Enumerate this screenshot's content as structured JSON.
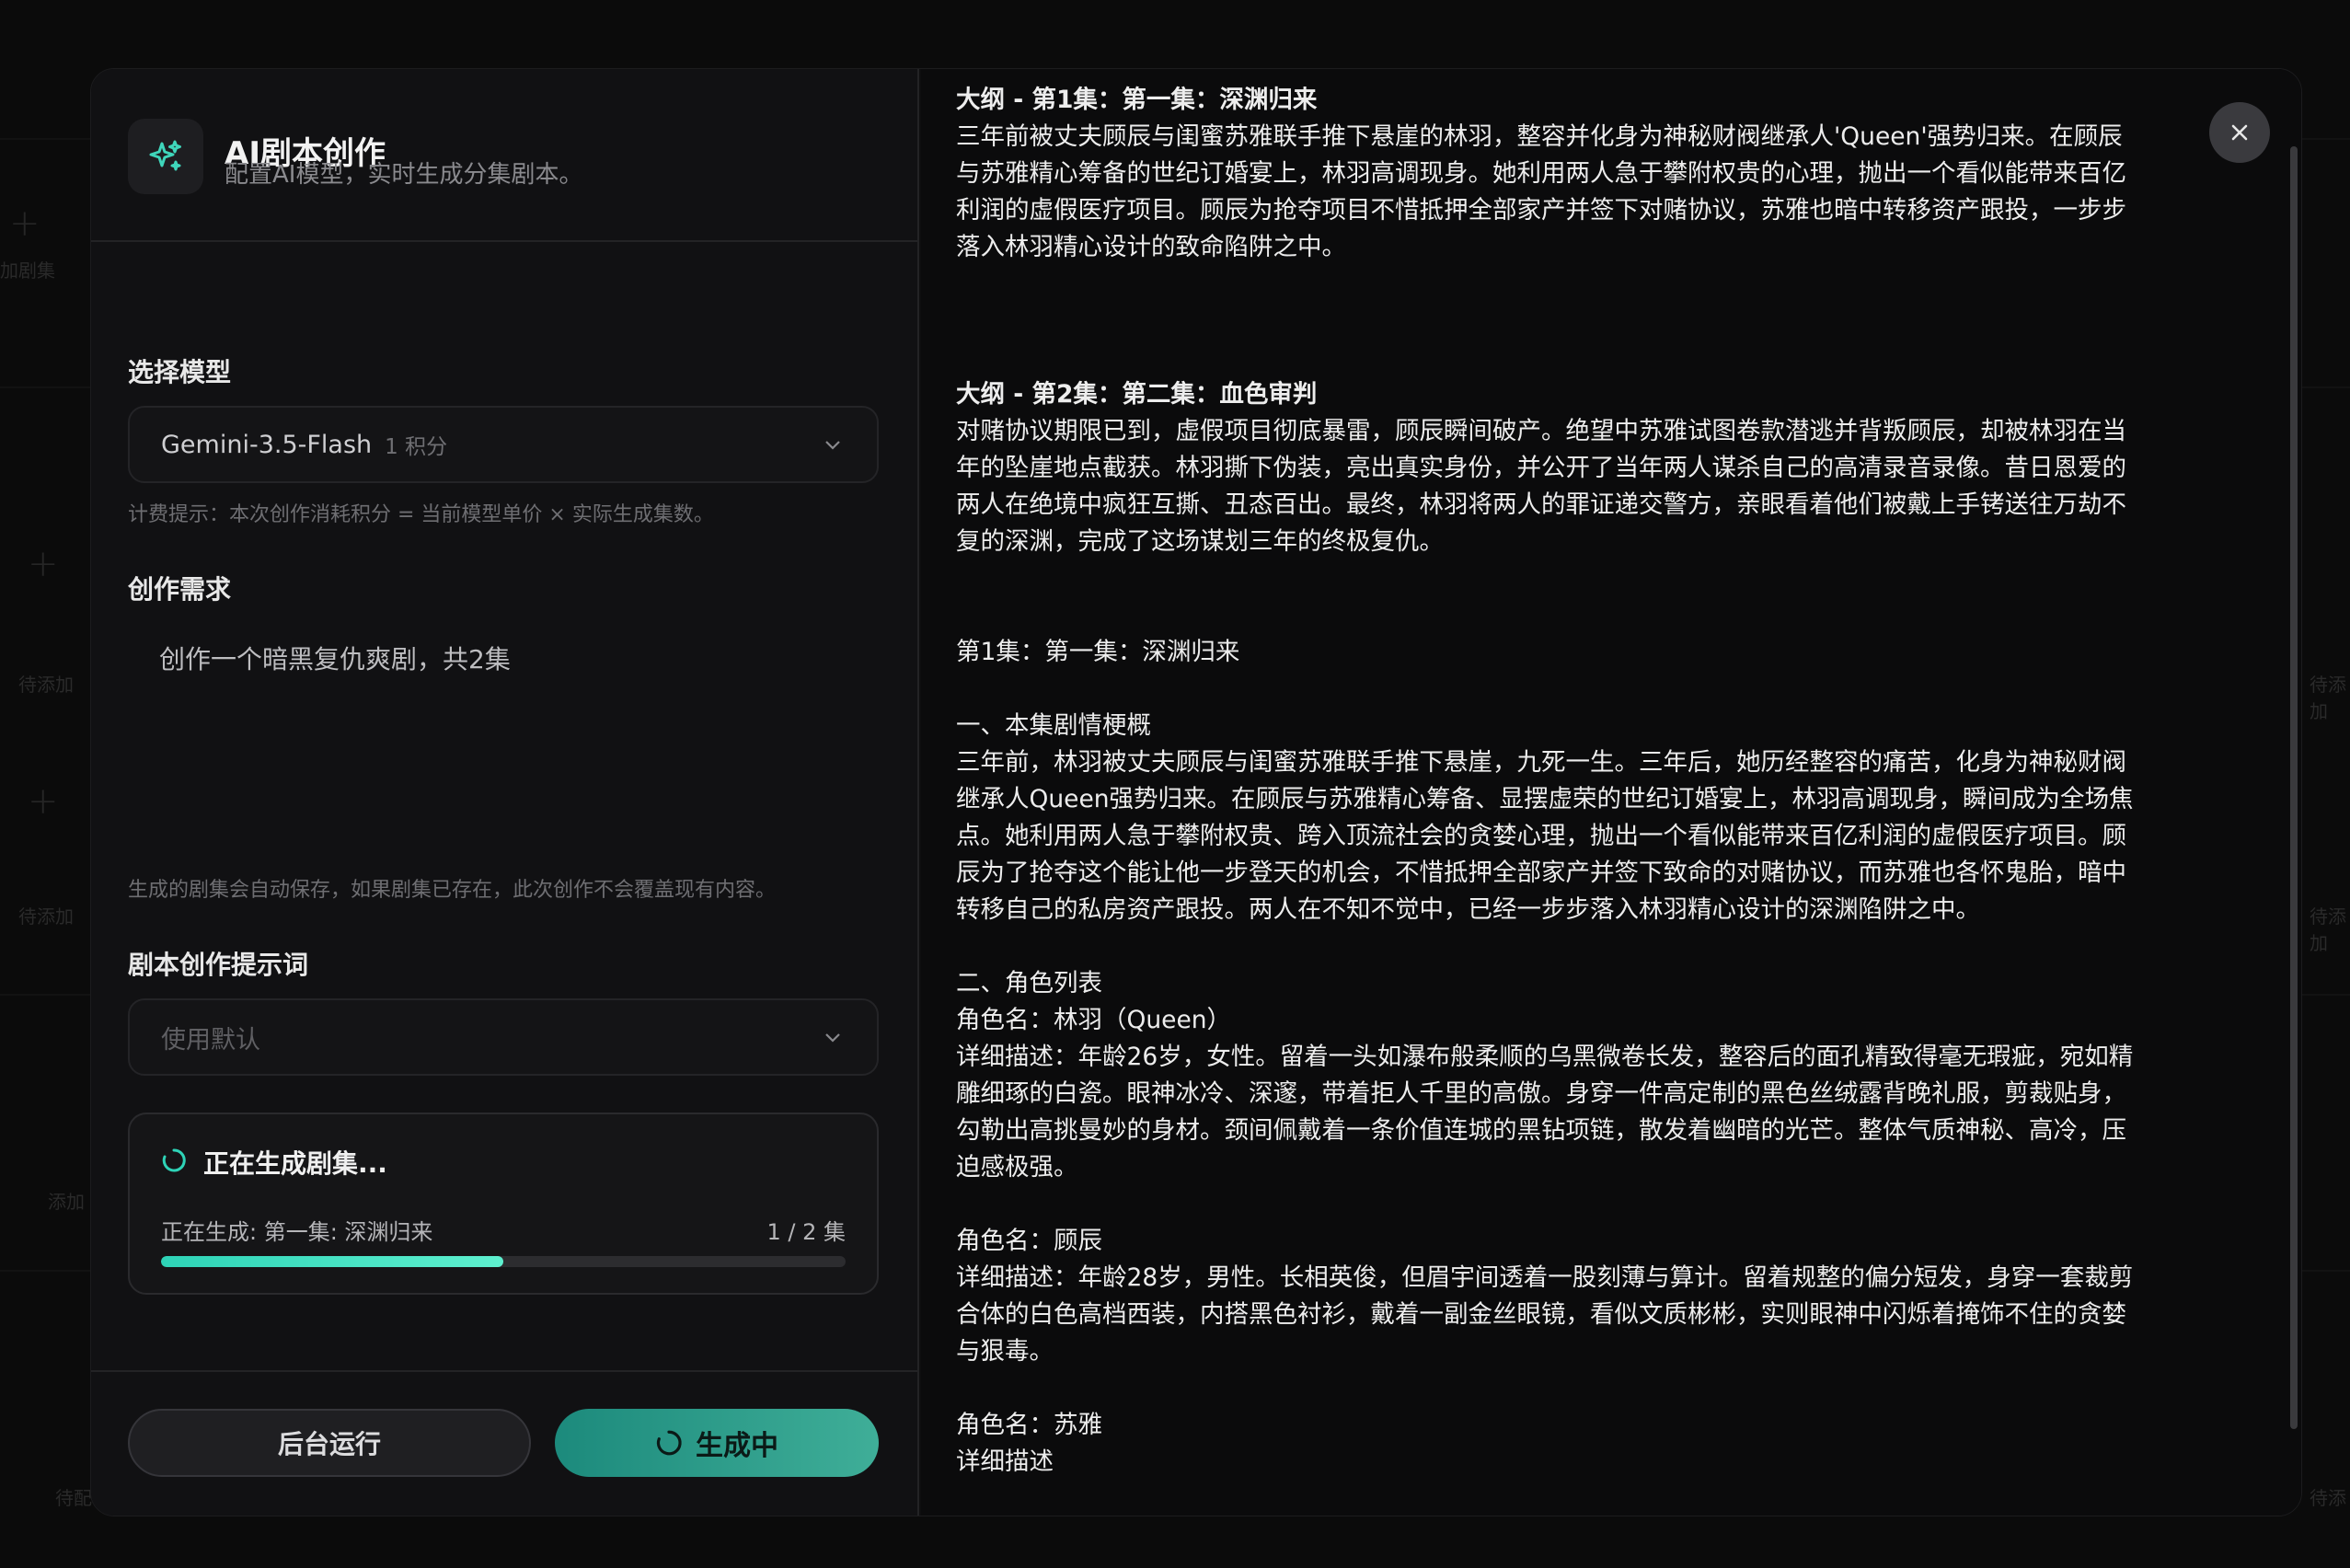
{
  "background_app": {
    "labels": [
      "加剧集",
      "待添加",
      "待添加",
      "添加",
      "待配"
    ],
    "right_labels": [
      "待添加",
      "待添加",
      "待添"
    ]
  },
  "modal": {
    "title": "AI剧本创作",
    "subtitle": "配置AI模型，实时生成分集剧本。",
    "model_section": {
      "label": "选择模型",
      "selected_model": "Gemini-3.5-Flash",
      "cost_tag": "1 积分",
      "hint": "计费提示：本次创作消耗积分 = 当前模型单价 × 实际生成集数。"
    },
    "requirement_section": {
      "label": "创作需求",
      "value": "创作一个暗黑复仇爽剧，共2集",
      "hint": "生成的剧集会自动保存，如果剧集已存在，此次创作不会覆盖现有内容。"
    },
    "prompt_section": {
      "label": "剧本创作提示词",
      "placeholder": "使用默认"
    },
    "progress": {
      "title": "正在生成剧集...",
      "status": "正在生成: 第一集: 深渊归来",
      "count": "1 / 2 集",
      "fraction": 0.5
    },
    "buttons": {
      "background_run": "后台运行",
      "generating": "生成中"
    }
  },
  "script_output": {
    "outline1_title": "大纲 - 第1集：第一集：深渊归来",
    "outline1_lines": [
      "三年前被丈夫顾辰与闺蜜苏雅联手推下悬崖的林羽，整容并化身为神秘财阀继承人'Queen'强势归来。在顾辰",
      "与苏雅精心筹备的世纪订婚宴上，林羽高调现身。她利用两人急于攀附权贵的心理，抛出一个看似能带来百亿",
      "利润的虚假医疗项目。顾辰为抢夺项目不惜抵押全部家产并签下对赌协议，苏雅也暗中转移资产跟投，一步步",
      "落入林羽精心设计的致命陷阱之中。"
    ],
    "outline2_title": "大纲 - 第2集：第二集：血色审判",
    "outline2_lines": [
      "对赌协议期限已到，虚假项目彻底暴雷，顾辰瞬间破产。绝望中苏雅试图卷款潜逃并背叛顾辰，却被林羽在当",
      "年的坠崖地点截获。林羽撕下伪装，亮出真实身份，并公开了当年两人谋杀自己的高清录音录像。昔日恩爱的",
      "两人在绝境中疯狂互撕、丑态百出。最终，林羽将两人的罪证递交警方，亲眼看着他们被戴上手铐送往万劫不",
      "复的深渊，完成了这场谋划三年的终极复仇。"
    ],
    "episode1_title": "第1集：第一集：深渊归来",
    "summary_heading": "一、本集剧情梗概",
    "summary_lines": [
      "三年前，林羽被丈夫顾辰与闺蜜苏雅联手推下悬崖，九死一生。三年后，她历经整容的痛苦，化身为神秘财阀",
      "继承人Queen强势归来。在顾辰与苏雅精心筹备、显摆虚荣的世纪订婚宴上，林羽高调现身，瞬间成为全场焦",
      "点。她利用两人急于攀附权贵、跨入顶流社会的贪婪心理，抛出一个看似能带来百亿利润的虚假医疗项目。顾",
      "辰为了抢夺这个能让他一步登天的机会，不惜抵押全部家产并签下致命的对赌协议，而苏雅也各怀鬼胎，暗中",
      "转移自己的私房资产跟投。两人在不知不觉中，已经一步步落入林羽精心设计的深渊陷阱之中。"
    ],
    "roles_heading": "二、角色列表",
    "role1_name": "角色名：林羽（Queen）",
    "role1_lines": [
      "详细描述：年龄26岁，女性。留着一头如瀑布般柔顺的乌黑微卷长发，整容后的面孔精致得毫无瑕疵，宛如精",
      "雕细琢的白瓷。眼神冰冷、深邃，带着拒人千里的高傲。身穿一件高定制的黑色丝绒露背晚礼服，剪裁贴身，",
      "勾勒出高挑曼妙的身材。颈间佩戴着一条价值连城的黑钻项链，散发着幽暗的光芒。整体气质神秘、高冷，压",
      "迫感极强。"
    ],
    "role2_name": "角色名：顾辰",
    "role2_lines": [
      "详细描述：年龄28岁，男性。长相英俊，但眉宇间透着一股刻薄与算计。留着规整的偏分短发，身穿一套裁剪",
      "合体的白色高档西装，内搭黑色衬衫，戴着一副金丝眼镜，看似文质彬彬，实则眼神中闪烁着掩饰不住的贪婪",
      "与狠毒。"
    ],
    "role3_name": "角色名：苏雅",
    "role3_partial": "详细描述"
  },
  "colors": {
    "accent": "#2ed3b7",
    "button_gradient_start": "#1c8a7c",
    "button_gradient_end": "#3fae98"
  }
}
